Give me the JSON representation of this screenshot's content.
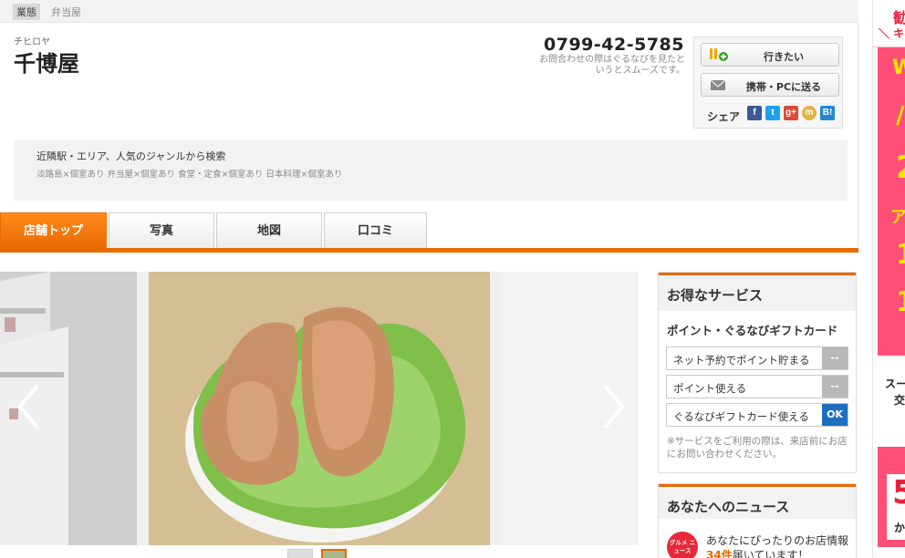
{
  "category": {
    "label": "業態",
    "value": "弁当屋"
  },
  "shop": {
    "kana": "チヒロヤ",
    "name": "千博屋"
  },
  "contact": {
    "phone": "0799-42-5785",
    "note": "お問合わせの際はぐるなびを見たというとスムーズです。"
  },
  "actions": {
    "want_to_go": "行きたい",
    "send_to_mobile": "携帯・PCに送る",
    "share_label": "シェア",
    "sns": [
      "f",
      "t",
      "g+",
      "m",
      "B!"
    ]
  },
  "search": {
    "title": "近隣駅・エリア、人気のジャンルから検索",
    "links": "淡路島×個室あり 弁当屋×個室あり 食堂・定食×個室あり 日本料理×個室あり"
  },
  "tabs": [
    "店舗トップ",
    "写真",
    "地図",
    "口コミ"
  ],
  "services": {
    "title": "お得なサービス",
    "subtitle": "ポイント・ぐるなびギフトカード",
    "rows": [
      {
        "label": "ネット予約でポイント貯まる",
        "status": "--"
      },
      {
        "label": "ポイント使える",
        "status": "--"
      },
      {
        "label": "ぐるなびギフトカード使える",
        "status": "OK"
      }
    ],
    "note": "※サービスをご利用の際は、来店前にお店にお問い合わせください。"
  },
  "news": {
    "title": "あなたへのニュース",
    "icon_text": "グルメ ニュース",
    "text_prefix": "あなたにぴったりのお店情報",
    "count": "34件",
    "text_suffix": "届いています！"
  },
  "ad": {
    "top_char": "勧",
    "top_sub": "＼ キ",
    "chars": [
      "W",
      "/",
      "2",
      "ア",
      "1",
      "1"
    ],
    "middle_1": "スー",
    "middle_2": "交",
    "bottom_big": "5",
    "bottom_small": "か"
  },
  "colors": {
    "accent": "#e86a00",
    "ok": "#1f6fbf",
    "ad_pink": "#ff4f76"
  }
}
